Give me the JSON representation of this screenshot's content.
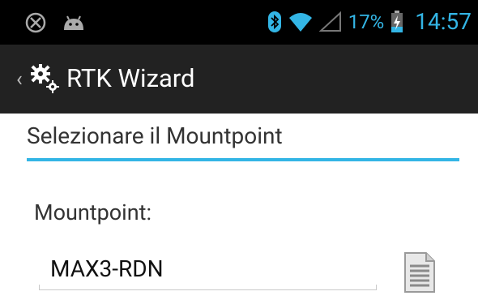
{
  "status_bar": {
    "icons_left": [
      "blocked-icon",
      "android-icon"
    ],
    "icons_right": [
      "bluetooth-icon",
      "wifi-icon",
      "signal-icon",
      "battery-charging-icon"
    ],
    "battery_percent": "17%",
    "time": "14:57",
    "accent_color": "#33b5e5"
  },
  "action_bar": {
    "title": "RTK Wizard",
    "icon": "settings-gears-icon"
  },
  "section": {
    "title": "Selezionare il Mountpoint"
  },
  "mountpoint": {
    "label": "Mountpoint:",
    "value": "MAX3-RDN",
    "action_icon": "document-list-icon"
  }
}
